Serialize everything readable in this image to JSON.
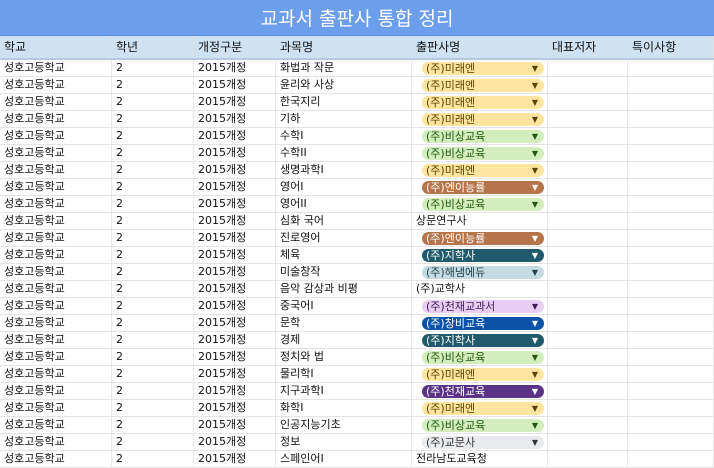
{
  "title": "교과서 출판사 통합 정리",
  "headers": [
    "학교",
    "학년",
    "개정구분",
    "과목명",
    "출판사명",
    "대표저자",
    "특이사항"
  ],
  "chip_colors": {
    "yellow": "#ffe59f",
    "green": "#d4edbc",
    "brown": "#b5744a",
    "teal": "#215a6c",
    "lightblue": "#c6dbe1",
    "lavender": "#e6cff2",
    "navy": "#0a53a8",
    "purple": "#5a3286",
    "gray": "#e8eaed"
  },
  "dropdown_icon": "triangle-down-icon",
  "rows": [
    {
      "school": "성호고등학교",
      "grade": "2",
      "revision": "2015개정",
      "subject": "화법과 작문",
      "publisher": "(주)미래엔",
      "chip": "yellow"
    },
    {
      "school": "성호고등학교",
      "grade": "2",
      "revision": "2015개정",
      "subject": "윤리와 사상",
      "publisher": "(주)미래엔",
      "chip": "yellow"
    },
    {
      "school": "성호고등학교",
      "grade": "2",
      "revision": "2015개정",
      "subject": "한국지리",
      "publisher": "(주)미래엔",
      "chip": "yellow"
    },
    {
      "school": "성호고등학교",
      "grade": "2",
      "revision": "2015개정",
      "subject": "기하",
      "publisher": "(주)미래엔",
      "chip": "yellow"
    },
    {
      "school": "성호고등학교",
      "grade": "2",
      "revision": "2015개정",
      "subject": "수학I",
      "publisher": "(주)비상교육",
      "chip": "green"
    },
    {
      "school": "성호고등학교",
      "grade": "2",
      "revision": "2015개정",
      "subject": "수학II",
      "publisher": "(주)비상교육",
      "chip": "green"
    },
    {
      "school": "성호고등학교",
      "grade": "2",
      "revision": "2015개정",
      "subject": "생명과학I",
      "publisher": "(주)미래엔",
      "chip": "yellow"
    },
    {
      "school": "성호고등학교",
      "grade": "2",
      "revision": "2015개정",
      "subject": "영어I",
      "publisher": "(주)엔이능률",
      "chip": "brown"
    },
    {
      "school": "성호고등학교",
      "grade": "2",
      "revision": "2015개정",
      "subject": "영어II",
      "publisher": "(주)비상교육",
      "chip": "green"
    },
    {
      "school": "성호고등학교",
      "grade": "2",
      "revision": "2015개정",
      "subject": "심화 국어",
      "publisher": "상문연구사",
      "chip": "none"
    },
    {
      "school": "성호고등학교",
      "grade": "2",
      "revision": "2015개정",
      "subject": "진로영어",
      "publisher": "(주)엔이능률",
      "chip": "brown"
    },
    {
      "school": "성호고등학교",
      "grade": "2",
      "revision": "2015개정",
      "subject": "체육",
      "publisher": "(주)지학사",
      "chip": "teal"
    },
    {
      "school": "성호고등학교",
      "grade": "2",
      "revision": "2015개정",
      "subject": "미술창작",
      "publisher": "(주)해냄에듀",
      "chip": "lightblue"
    },
    {
      "school": "성호고등학교",
      "grade": "2",
      "revision": "2015개정",
      "subject": "음악 감상과 비평",
      "publisher": "(주)교학사",
      "chip": "none"
    },
    {
      "school": "성호고등학교",
      "grade": "2",
      "revision": "2015개정",
      "subject": "중국어I",
      "publisher": "(주)천재교과서",
      "chip": "lavender"
    },
    {
      "school": "성호고등학교",
      "grade": "2",
      "revision": "2015개정",
      "subject": "문학",
      "publisher": "(주)창비교육",
      "chip": "navy"
    },
    {
      "school": "성호고등학교",
      "grade": "2",
      "revision": "2015개정",
      "subject": "경제",
      "publisher": "(주)지학사",
      "chip": "teal"
    },
    {
      "school": "성호고등학교",
      "grade": "2",
      "revision": "2015개정",
      "subject": "정치와 법",
      "publisher": "(주)비상교육",
      "chip": "green"
    },
    {
      "school": "성호고등학교",
      "grade": "2",
      "revision": "2015개정",
      "subject": "물리학I",
      "publisher": "(주)미래엔",
      "chip": "yellow"
    },
    {
      "school": "성호고등학교",
      "grade": "2",
      "revision": "2015개정",
      "subject": "지구과학I",
      "publisher": "(주)천재교육",
      "chip": "purple"
    },
    {
      "school": "성호고등학교",
      "grade": "2",
      "revision": "2015개정",
      "subject": "화학I",
      "publisher": "(주)미래엔",
      "chip": "yellow"
    },
    {
      "school": "성호고등학교",
      "grade": "2",
      "revision": "2015개정",
      "subject": "인공지능기초",
      "publisher": "(주)비상교육",
      "chip": "green"
    },
    {
      "school": "성호고등학교",
      "grade": "2",
      "revision": "2015개정",
      "subject": "정보",
      "publisher": "(주)교문사",
      "chip": "gray"
    },
    {
      "school": "성호고등학교",
      "grade": "2",
      "revision": "2015개정",
      "subject": "스페인어I",
      "publisher": "전라남도교육청",
      "chip": "none"
    }
  ]
}
